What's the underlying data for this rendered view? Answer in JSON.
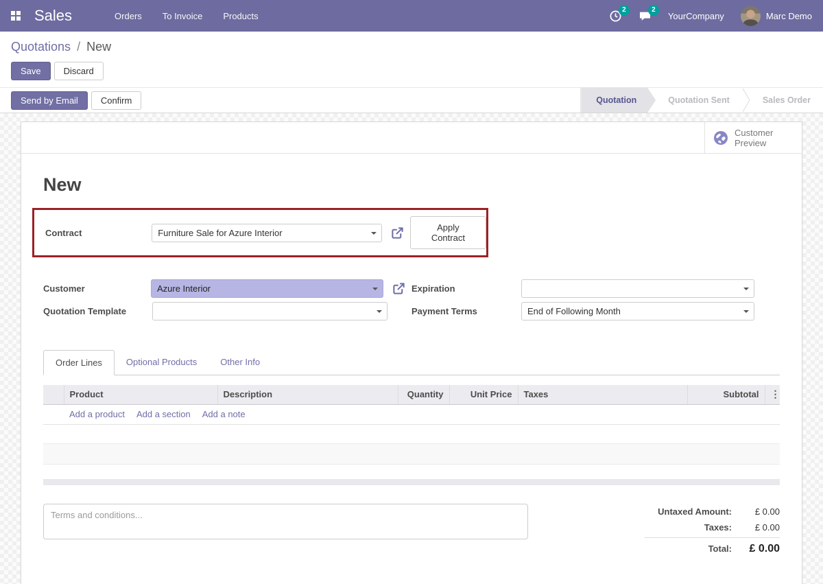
{
  "navbar": {
    "app_name": "Sales",
    "menu_items": [
      "Orders",
      "To Invoice",
      "Products"
    ],
    "activity_badge": "2",
    "message_badge": "2",
    "company": "YourCompany",
    "user": "Marc Demo"
  },
  "breadcrumb": {
    "parent": "Quotations",
    "separator": "/",
    "current": "New"
  },
  "control_buttons": {
    "save": "Save",
    "discard": "Discard"
  },
  "action_bar": {
    "send_by_email": "Send by Email",
    "confirm": "Confirm",
    "statusbar": [
      {
        "label": "Quotation",
        "active": true
      },
      {
        "label": "Quotation Sent",
        "active": false
      },
      {
        "label": "Sales Order",
        "active": false
      }
    ]
  },
  "sheet": {
    "preview_button": "Customer Preview",
    "title": "New",
    "contract": {
      "label": "Contract",
      "value": "Furniture Sale for Azure Interior",
      "apply_button": "Apply Contract"
    },
    "fields": {
      "customer": {
        "label": "Customer",
        "value": "Azure Interior"
      },
      "quotation_template": {
        "label": "Quotation Template",
        "value": ""
      },
      "expiration": {
        "label": "Expiration",
        "value": ""
      },
      "payment_terms": {
        "label": "Payment Terms",
        "value": "End of Following Month"
      }
    },
    "tabs": [
      {
        "label": "Order Lines"
      },
      {
        "label": "Optional Products"
      },
      {
        "label": "Other Info"
      }
    ],
    "order_table": {
      "columns": [
        "Product",
        "Description",
        "Quantity",
        "Unit Price",
        "Taxes",
        "Subtotal"
      ],
      "add_links": [
        "Add a product",
        "Add a section",
        "Add a note"
      ],
      "rows": []
    },
    "terms_placeholder": "Terms and conditions...",
    "totals": {
      "untaxed_label": "Untaxed Amount:",
      "untaxed_value": "£ 0.00",
      "taxes_label": "Taxes:",
      "taxes_value": "£ 0.00",
      "total_label": "Total:",
      "total_value": "£ 0.00"
    }
  },
  "icons": {
    "apps-grid-icon": "2x2 white squares",
    "activity-clock-icon": "clock outline",
    "messages-icon": "chat bubble",
    "globe-icon": "purple globe",
    "external-link-icon": "box with arrow",
    "dropdown-caret-icon": "down triangle",
    "kebab-icon": "⋮"
  },
  "colors": {
    "navbar_bg": "#6d6b9f",
    "badge_teal": "#00a09d",
    "primary_button": "#716fa3",
    "link_purple": "#6f6ea8",
    "highlight_red": "#9c2127",
    "customer_highlight": "#b7b5e4",
    "active_step_bg": "#e2e2e7"
  }
}
